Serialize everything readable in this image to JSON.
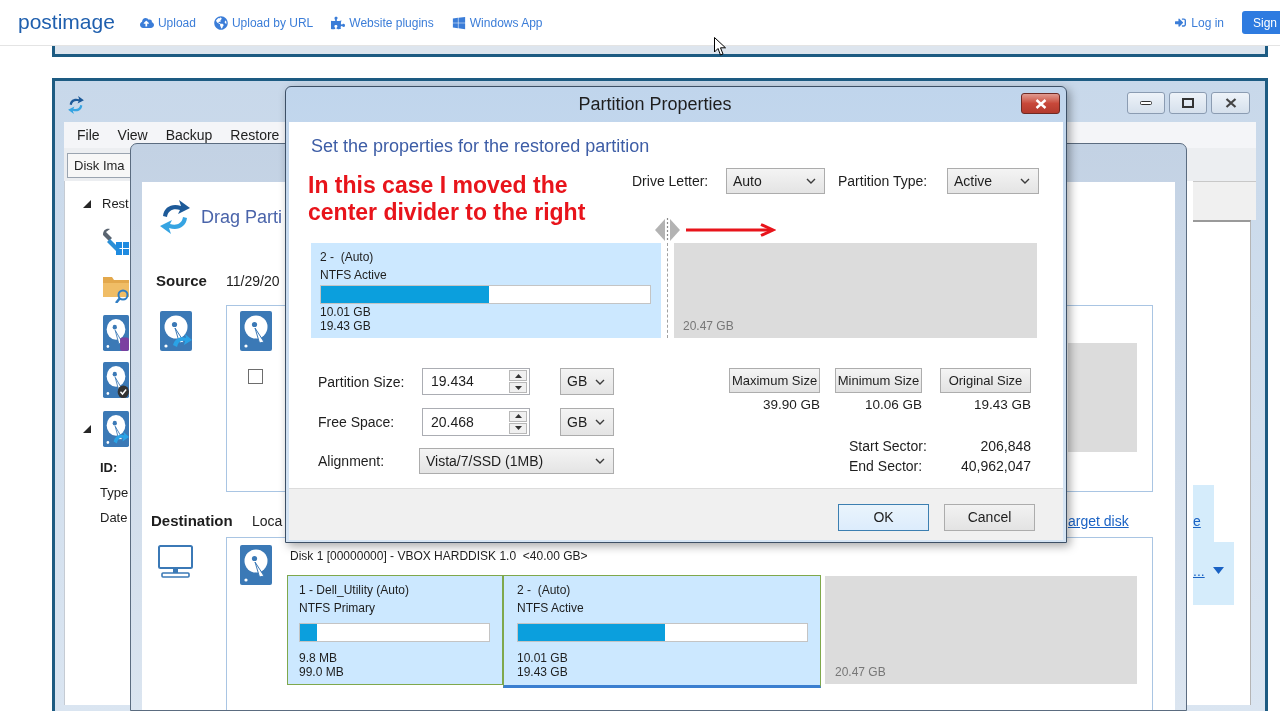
{
  "site_header": {
    "logo": "postimage",
    "nav": [
      {
        "label": "Upload"
      },
      {
        "label": "Upload by URL"
      },
      {
        "label": "Website plugins"
      },
      {
        "label": "Windows App"
      }
    ],
    "login": "Log in",
    "signup": "Sign"
  },
  "app_window": {
    "menu": [
      "File",
      "View",
      "Backup",
      "Restore"
    ],
    "tabs": [
      {
        "label": "Disk Ima",
        "selected": true
      }
    ],
    "tree": [
      {
        "label": "Rest",
        "expanded": true
      },
      {
        "expanded": true
      }
    ],
    "details": [
      {
        "label": "ID:",
        "bold": true
      },
      {
        "label": "Type",
        "bold": false
      },
      {
        "label": "Date",
        "bold": false
      }
    ],
    "side_links": [
      "e",
      "..."
    ]
  },
  "wizard": {
    "title": "Drag Parti",
    "source": {
      "label": "Source",
      "date": "11/29/20",
      "checked": false
    },
    "destination": {
      "label": "Destination",
      "location": "Loca",
      "link": "arget disk",
      "disk": "Disk 1 [00000000] - VBOX HARDDISK 1.0  <40.00 GB>",
      "partitions": [
        {
          "name": "1 - Dell_Utility (Auto)",
          "fs": "NTFS Primary",
          "level": 0.09,
          "used": "9.8 MB",
          "size": "99.0 MB",
          "selected": false
        },
        {
          "name": "2 -  (Auto)",
          "fs": "NTFS Active",
          "level": 0.51,
          "used": "10.01 GB",
          "size": "19.43 GB",
          "selected": true
        }
      ],
      "unallocated": "20.47 GB"
    }
  },
  "dialog": {
    "title": "Partition Properties",
    "subtitle": "Set the properties for the restored partition",
    "annotation": {
      "lines": [
        "In this case I moved the",
        "center divider to the right"
      ]
    },
    "drive_letter": {
      "label": "Drive Letter:",
      "value": "Auto"
    },
    "partition_type": {
      "label": "Partition Type:",
      "value": "Active"
    },
    "partition": {
      "name": "2 -  (Auto)",
      "fs": "NTFS Active",
      "level": 0.51,
      "used": "10.01 GB",
      "size": "19.43 GB"
    },
    "unallocated": "20.47 GB",
    "fields": [
      {
        "label": "Partition Size:",
        "value": "19.434",
        "unit": "GB"
      },
      {
        "label": "Free Space:",
        "value": "20.468",
        "unit": "GB"
      }
    ],
    "alignment": {
      "label": "Alignment:",
      "value": "Vista/7/SSD (1MB)"
    },
    "size_buttons": [
      {
        "label": "Maximum Size",
        "value": "39.90 GB"
      },
      {
        "label": "Minimum Size",
        "value": "10.06 GB"
      },
      {
        "label": "Original Size",
        "value": "19.43 GB"
      }
    ],
    "sectors": [
      {
        "label": "Start Sector:",
        "value": "206,848"
      },
      {
        "label": "End Sector:",
        "value": "40,962,047"
      }
    ],
    "buttons": [
      {
        "label": "OK",
        "default": true
      },
      {
        "label": "Cancel",
        "default": false
      }
    ]
  }
}
